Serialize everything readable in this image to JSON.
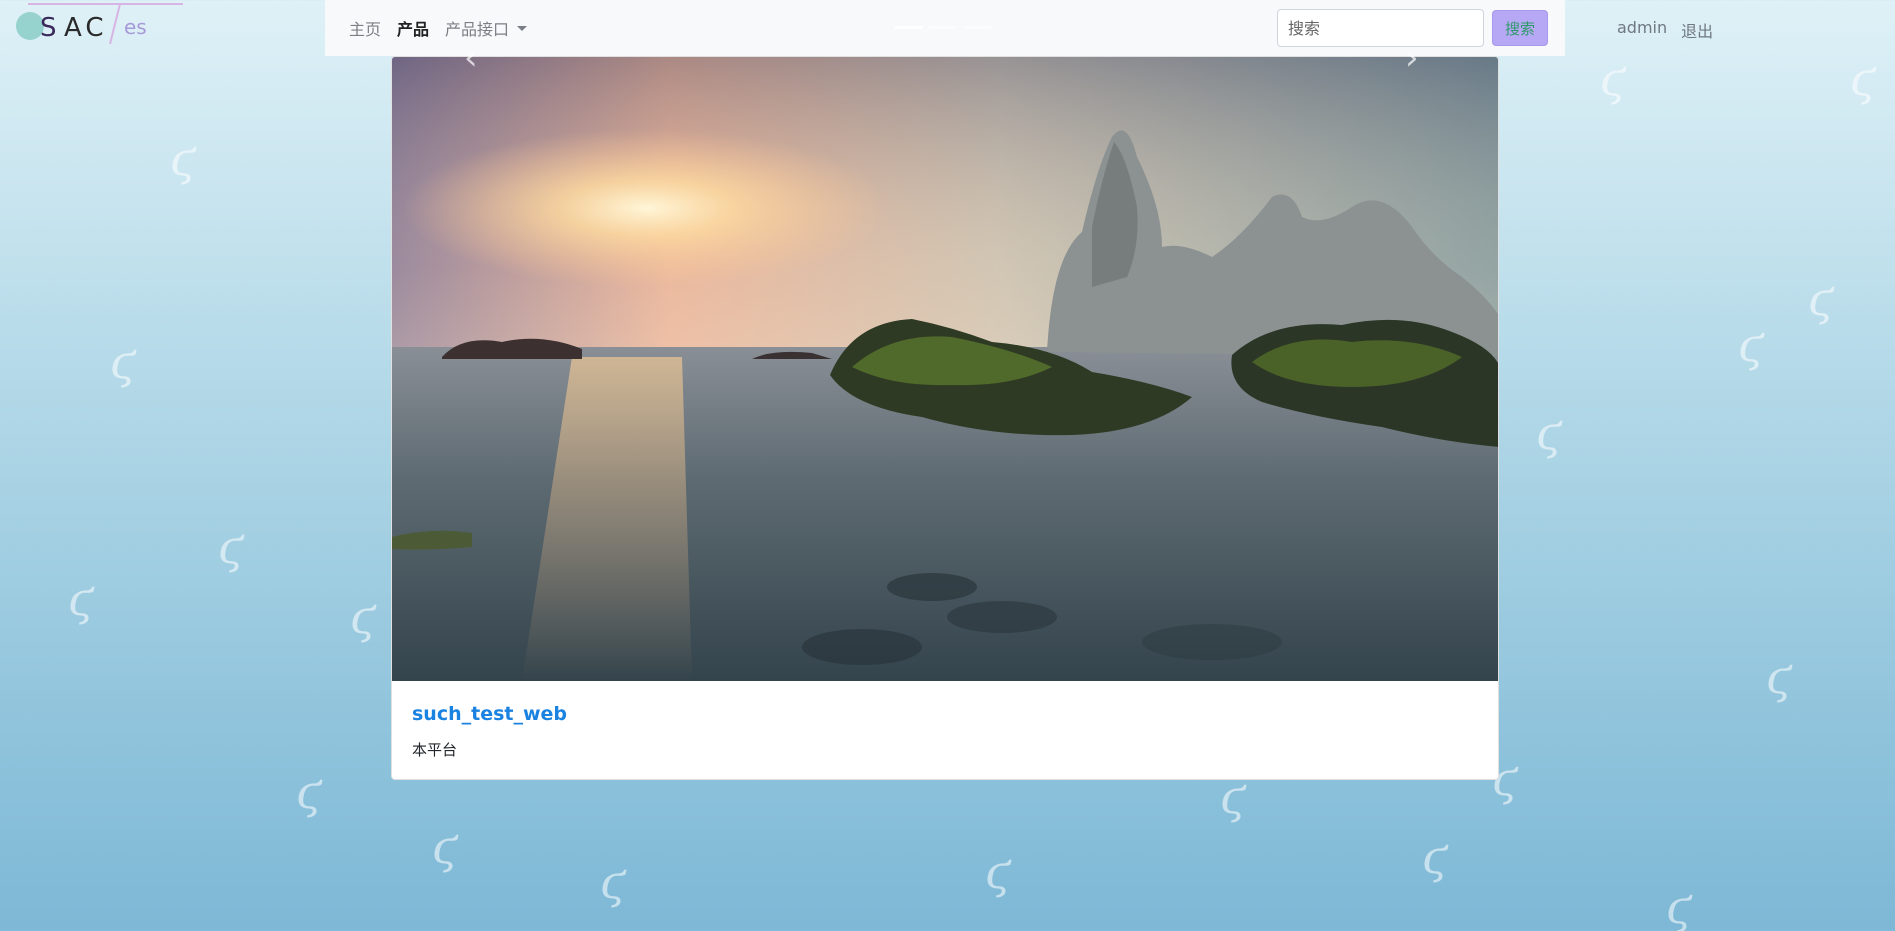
{
  "logo": {
    "text_parts": [
      "S",
      "AC",
      "es"
    ],
    "accent_colors": [
      "#7fc8c0",
      "#c9a3e8",
      "#2a2a2a"
    ]
  },
  "navbar": {
    "items": [
      {
        "label": "主页"
      },
      {
        "label": "产品"
      },
      {
        "label": "产品接口"
      }
    ]
  },
  "search": {
    "placeholder": "搜索",
    "button_label": "搜索"
  },
  "user": {
    "name": "admin",
    "logout_label": "退出"
  },
  "carousel": {
    "prev_icon": "‹",
    "next_icon": "›",
    "slide_count": 3,
    "active_slide": 1
  },
  "card": {
    "title": "such_test_web",
    "text": "本平台"
  },
  "colors": {
    "link": "#1a82e0",
    "search_button_bg": "#b7a8f5",
    "search_button_text": "#2e9a6a",
    "navbar_bg": "#f8f9fa"
  }
}
